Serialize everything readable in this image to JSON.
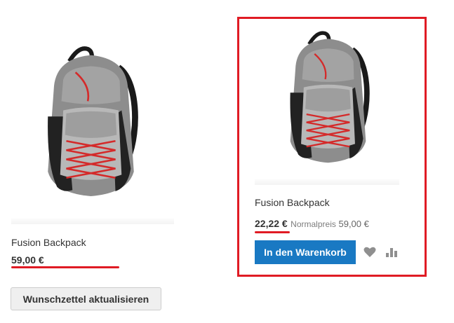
{
  "products": [
    {
      "name": "Fusion Backpack",
      "price": "59,00 €"
    },
    {
      "name": "Fusion Backpack",
      "price": "22,22 €",
      "regular_price_label": "Normalpreis",
      "regular_price": "59,00 €",
      "add_to_cart_label": "In den Warenkorb",
      "wishlist_icon": "heart-icon",
      "compare_icon": "bar-chart-icon"
    }
  ],
  "update_wishlist_label": "Wunschzettel aktualisieren",
  "colors": {
    "highlight": "#e01b24",
    "primary_button": "#1979c3",
    "icon_gray": "#8f8f8f",
    "backpack_gray": "#8d8d8d",
    "backpack_red": "#d42a2a"
  }
}
